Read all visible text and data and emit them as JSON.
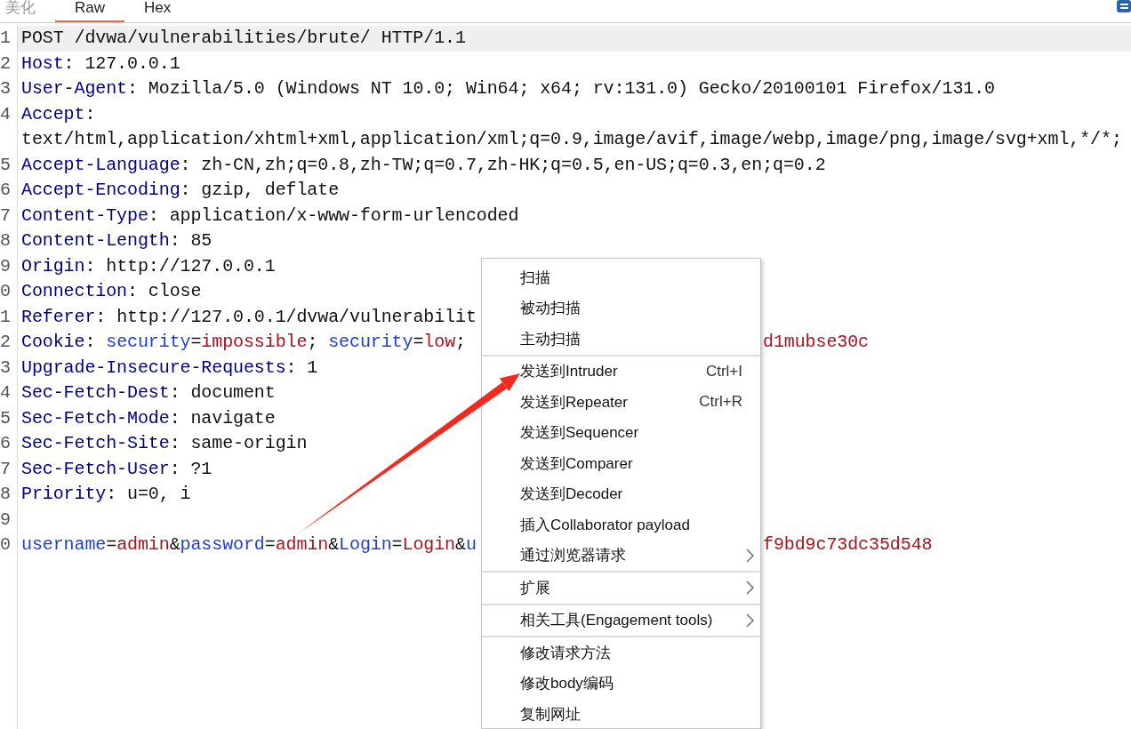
{
  "tabs": [
    {
      "label": "美化",
      "selected": false,
      "disabled": true
    },
    {
      "label": "Raw",
      "selected": true,
      "disabled": false
    },
    {
      "label": "Hex",
      "selected": false,
      "disabled": false
    }
  ],
  "editor": {
    "lines": [
      {
        "number": "1",
        "highlighted": true,
        "segments": [
          {
            "kind": "text",
            "text": "POST /dvwa/vulnerabilities/brute/ HTTP/1.1"
          }
        ]
      },
      {
        "number": "2",
        "highlighted": false,
        "segments": [
          {
            "kind": "header",
            "text": "Host"
          },
          {
            "kind": "text",
            "text": ": 127.0.0.1"
          }
        ]
      },
      {
        "number": "3",
        "highlighted": false,
        "segments": [
          {
            "kind": "header",
            "text": "User-Agent"
          },
          {
            "kind": "text",
            "text": ": Mozilla/5.0 (Windows NT 10.0; Win64; x64; rv:131.0) Gecko/20100101 Firefox/131.0"
          }
        ]
      },
      {
        "number": "4",
        "highlighted": false,
        "segments": [
          {
            "kind": "header",
            "text": "Accept"
          },
          {
            "kind": "text",
            "text": ":"
          }
        ]
      },
      {
        "highlighted": false,
        "segments": [
          {
            "kind": "text",
            "text": "text/html,application/xhtml+xml,application/xml;q=0.9,image/avif,image/webp,image/png,image/svg+xml,*/*;"
          }
        ]
      },
      {
        "number": "5",
        "highlighted": false,
        "segments": [
          {
            "kind": "header",
            "text": "Accept-Language"
          },
          {
            "kind": "text",
            "text": ": zh-CN,zh;q=0.8,zh-TW;q=0.7,zh-HK;q=0.5,en-US;q=0.3,en;q=0.2"
          }
        ]
      },
      {
        "number": "6",
        "highlighted": false,
        "segments": [
          {
            "kind": "header",
            "text": "Accept-Encoding"
          },
          {
            "kind": "text",
            "text": ": gzip, deflate"
          }
        ]
      },
      {
        "number": "7",
        "highlighted": false,
        "segments": [
          {
            "kind": "header",
            "text": "Content-Type"
          },
          {
            "kind": "text",
            "text": ": application/x-www-form-urlencoded"
          }
        ]
      },
      {
        "number": "8",
        "highlighted": false,
        "segments": [
          {
            "kind": "header",
            "text": "Content-Length"
          },
          {
            "kind": "text",
            "text": ": 85"
          }
        ]
      },
      {
        "number": "9",
        "highlighted": false,
        "segments": [
          {
            "kind": "header",
            "text": "Origin"
          },
          {
            "kind": "text",
            "text": ": http://127.0.0.1"
          }
        ]
      },
      {
        "number": "0",
        "highlighted": false,
        "segments": [
          {
            "kind": "header",
            "text": "Connection"
          },
          {
            "kind": "text",
            "text": ": close"
          }
        ]
      },
      {
        "number": "1",
        "highlighted": false,
        "segments": [
          {
            "kind": "header",
            "text": "Referer"
          },
          {
            "kind": "text",
            "text": ": http://127.0.0.1/dvwa/vulnerabilit"
          }
        ]
      },
      {
        "number": "2",
        "highlighted": false,
        "segments": [
          {
            "kind": "header",
            "text": "Cookie"
          },
          {
            "kind": "text",
            "text": ": "
          },
          {
            "kind": "param",
            "text": "security"
          },
          {
            "kind": "text",
            "text": "="
          },
          {
            "kind": "value",
            "text": "impossible"
          },
          {
            "kind": "text",
            "text": "; "
          },
          {
            "kind": "param",
            "text": "security"
          },
          {
            "kind": "text",
            "text": "="
          },
          {
            "kind": "value",
            "text": "low"
          },
          {
            "kind": "text",
            "text": ";"
          }
        ],
        "tail": {
          "kind": "value",
          "text": "d1mubse30c"
        }
      },
      {
        "number": "3",
        "highlighted": false,
        "segments": [
          {
            "kind": "header",
            "text": "Upgrade-Insecure-Requests"
          },
          {
            "kind": "text",
            "text": ": 1"
          }
        ]
      },
      {
        "number": "4",
        "highlighted": false,
        "segments": [
          {
            "kind": "header",
            "text": "Sec-Fetch-Dest"
          },
          {
            "kind": "text",
            "text": ": document"
          }
        ]
      },
      {
        "number": "5",
        "highlighted": false,
        "segments": [
          {
            "kind": "header",
            "text": "Sec-Fetch-Mode"
          },
          {
            "kind": "text",
            "text": ": navigate"
          }
        ]
      },
      {
        "number": "6",
        "highlighted": false,
        "segments": [
          {
            "kind": "header",
            "text": "Sec-Fetch-Site"
          },
          {
            "kind": "text",
            "text": ": same-origin"
          }
        ]
      },
      {
        "number": "7",
        "highlighted": false,
        "segments": [
          {
            "kind": "header",
            "text": "Sec-Fetch-User"
          },
          {
            "kind": "text",
            "text": ": ?1"
          }
        ]
      },
      {
        "number": "8",
        "highlighted": false,
        "segments": [
          {
            "kind": "header",
            "text": "Priority"
          },
          {
            "kind": "text",
            "text": ": u=0, i"
          }
        ]
      },
      {
        "number": "9",
        "highlighted": false
      },
      {
        "number": "0",
        "highlighted": false,
        "segments": [
          {
            "kind": "param",
            "text": "username"
          },
          {
            "kind": "text",
            "text": "="
          },
          {
            "kind": "value",
            "text": "admin"
          },
          {
            "kind": "text",
            "text": "&"
          },
          {
            "kind": "param",
            "text": "password"
          },
          {
            "kind": "text",
            "text": "="
          },
          {
            "kind": "value",
            "text": "admin"
          },
          {
            "kind": "text",
            "text": "&"
          },
          {
            "kind": "param",
            "text": "Login"
          },
          {
            "kind": "text",
            "text": "="
          },
          {
            "kind": "value",
            "text": "Login"
          },
          {
            "kind": "text",
            "text": "&"
          },
          {
            "kind": "param",
            "text": "u"
          }
        ],
        "tail": {
          "kind": "value",
          "text": "f9bd9c73dc35d548"
        }
      }
    ]
  },
  "context_menu": {
    "groups": [
      [
        {
          "label": "扫描"
        },
        {
          "label": "被动扫描"
        },
        {
          "label": "主动扫描"
        }
      ],
      [
        {
          "label": "发送到Intruder",
          "shortcut": "Ctrl+I"
        },
        {
          "label": "发送到Repeater",
          "shortcut": "Ctrl+R"
        },
        {
          "label": "发送到Sequencer"
        },
        {
          "label": "发送到Comparer"
        },
        {
          "label": "发送到Decoder"
        },
        {
          "label": "插入Collaborator payload"
        },
        {
          "label": "通过浏览器请求",
          "has_submenu": true
        }
      ],
      [
        {
          "label": "扩展",
          "has_submenu": true
        }
      ],
      [
        {
          "label": "相关工具(Engagement tools)",
          "has_submenu": true
        }
      ],
      [
        {
          "label": "修改请求方法"
        },
        {
          "label": "修改body编码"
        },
        {
          "label": "复制网址"
        }
      ]
    ]
  }
}
